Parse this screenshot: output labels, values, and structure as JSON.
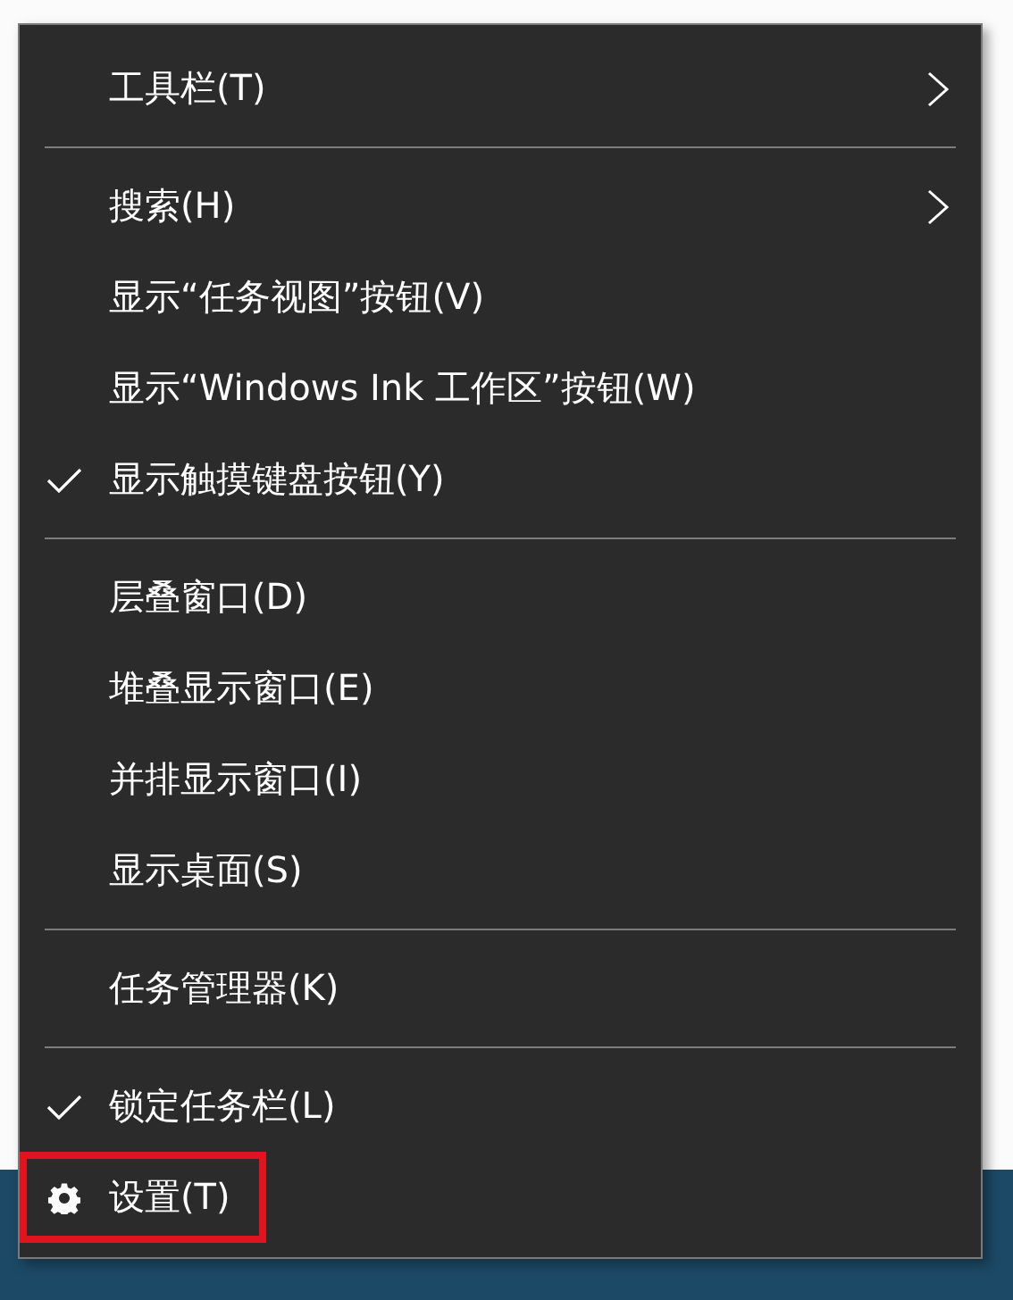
{
  "menu": {
    "groups": [
      {
        "items": [
          {
            "label": "工具栏(T)",
            "kind": "submenu",
            "checked": false,
            "highlighted": false
          }
        ]
      },
      {
        "items": [
          {
            "label": "搜索(H)",
            "kind": "submenu",
            "checked": false,
            "highlighted": false
          },
          {
            "label": "显示“任务视图”按钮(V)",
            "kind": "check",
            "checked": false,
            "highlighted": false
          },
          {
            "label": "显示“Windows Ink 工作区”按钮(W)",
            "kind": "check",
            "checked": false,
            "highlighted": false
          },
          {
            "label": "显示触摸键盘按钮(Y)",
            "kind": "check",
            "checked": true,
            "highlighted": false
          }
        ]
      },
      {
        "items": [
          {
            "label": "层叠窗口(D)",
            "kind": "plain",
            "checked": false,
            "highlighted": false
          },
          {
            "label": "堆叠显示窗口(E)",
            "kind": "plain",
            "checked": false,
            "highlighted": false
          },
          {
            "label": "并排显示窗口(I)",
            "kind": "plain",
            "checked": false,
            "highlighted": false
          },
          {
            "label": "显示桌面(S)",
            "kind": "plain",
            "checked": false,
            "highlighted": false
          }
        ]
      },
      {
        "items": [
          {
            "label": "任务管理器(K)",
            "kind": "plain",
            "checked": false,
            "highlighted": false
          }
        ]
      },
      {
        "items": [
          {
            "label": "锁定任务栏(L)",
            "kind": "check",
            "checked": true,
            "highlighted": false
          },
          {
            "label": "设置(T)",
            "kind": "settings",
            "checked": false,
            "highlighted": true
          }
        ]
      }
    ]
  }
}
